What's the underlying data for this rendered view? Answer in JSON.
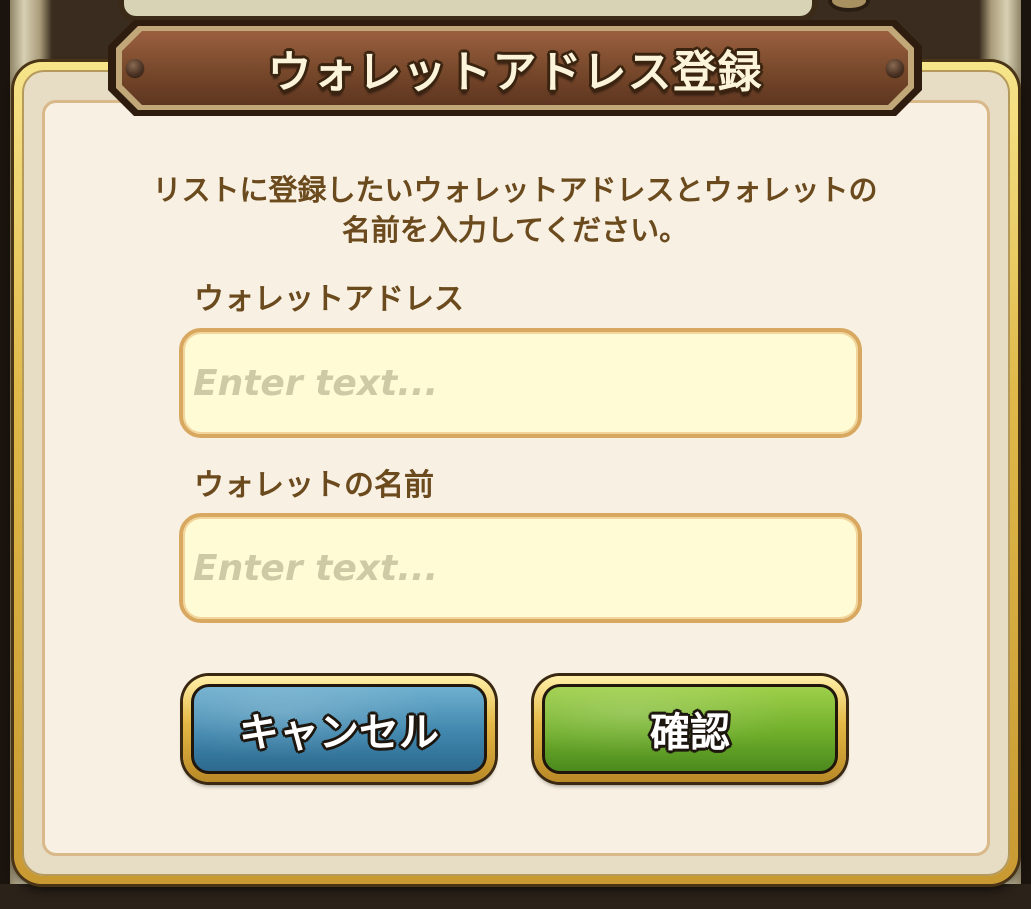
{
  "dialog": {
    "title": "ウォレットアドレス登録",
    "instructions_line1": "リストに登録したいウォレットアドレスとウォレットの",
    "instructions_line2": "名前を入力してください。"
  },
  "fields": {
    "address": {
      "label": "ウォレットアドレス",
      "value": "",
      "placeholder": "Enter text..."
    },
    "name": {
      "label": "ウォレットの名前",
      "value": "",
      "placeholder": "Enter text..."
    }
  },
  "buttons": {
    "cancel_label": "キャンセル",
    "confirm_label": "確認"
  },
  "colors": {
    "cancel_button": "#3f86ad",
    "confirm_button": "#6fae2a",
    "text_brown": "#6b4a1e",
    "banner_brown": "#7a4a2c",
    "frame_gold": "#e0b94a"
  }
}
